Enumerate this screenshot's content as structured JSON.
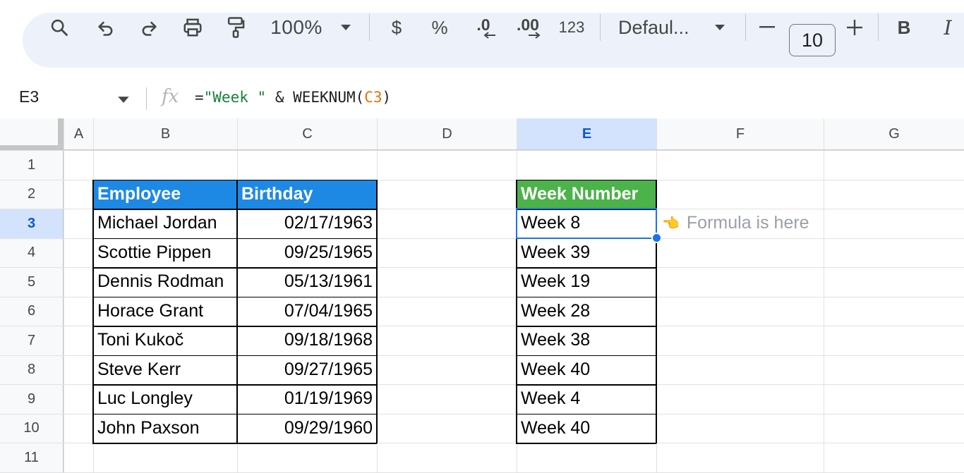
{
  "toolbar": {
    "zoom": "100%",
    "currency_label": "$",
    "percent_label": "%",
    "decrease_decimal_label": ".0",
    "increase_decimal_label": ".00",
    "number_format_label": "123",
    "font": "Defaul...",
    "font_size": "10",
    "bold_label": "B",
    "italic_label": "I"
  },
  "formula_bar": {
    "cell_ref": "E3",
    "fx_label": "fx",
    "formula_prefix": "=",
    "formula_string": "\"Week \"",
    "formula_middle": " & WEEKNUM(",
    "formula_ref": "C3",
    "formula_suffix": ")"
  },
  "columns": [
    "A",
    "B",
    "C",
    "D",
    "E",
    "F",
    "G"
  ],
  "rows": [
    "1",
    "2",
    "3",
    "4",
    "5",
    "6",
    "7",
    "8",
    "9",
    "10",
    "11"
  ],
  "selected": {
    "column": "E",
    "row": "3"
  },
  "employees_table": {
    "headers": {
      "employee": "Employee",
      "birthday": "Birthday"
    },
    "rows": [
      {
        "employee": "Michael Jordan",
        "birthday": "02/17/1963"
      },
      {
        "employee": "Scottie Pippen",
        "birthday": "09/25/1965"
      },
      {
        "employee": "Dennis Rodman",
        "birthday": "05/13/1961"
      },
      {
        "employee": "Horace Grant",
        "birthday": "07/04/1965"
      },
      {
        "employee": "Toni Kukoč",
        "birthday": "09/18/1968"
      },
      {
        "employee": "Steve Kerr",
        "birthday": "09/27/1965"
      },
      {
        "employee": "Luc Longley",
        "birthday": "01/19/1969"
      },
      {
        "employee": "John Paxson",
        "birthday": "09/29/1960"
      }
    ]
  },
  "week_table": {
    "header": "Week Number",
    "values": [
      "Week 8",
      "Week 39",
      "Week 19",
      "Week 28",
      "Week 38",
      "Week 40",
      "Week 4",
      "Week 40"
    ]
  },
  "annotation": {
    "pointer_emoji": "👈",
    "text": "Formula is here"
  },
  "colors": {
    "employee_header": "#1e88e5",
    "week_header": "#4cb24a",
    "selection": "#1a73e8",
    "formula_string": "#188038",
    "formula_ref": "#e8710a"
  }
}
